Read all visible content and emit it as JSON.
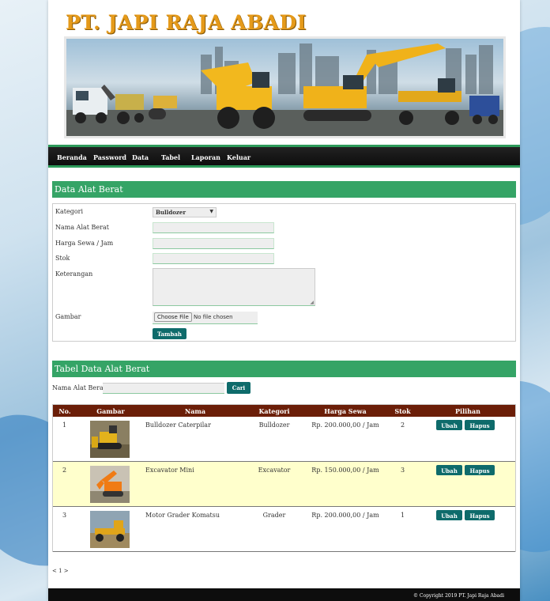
{
  "header": {
    "brand": "PT. JAPI RAJA ABADI"
  },
  "nav": [
    "Beranda",
    "Password",
    "Data",
    "Tabel",
    "Laporan",
    "Keluar"
  ],
  "form": {
    "title": "Data Alat Berat",
    "labels": {
      "kategori": "Kategori",
      "nama": "Nama Alat Berat",
      "harga": "Harga Sewa / Jam",
      "stok": "Stok",
      "keterangan": "Keterangan",
      "gambar": "Gambar"
    },
    "kategori_value": "Bulldozer",
    "file_button": "Choose File",
    "file_status": "No file chosen",
    "submit": "Tambah"
  },
  "table": {
    "title": "Tabel Data Alat Berat",
    "search_label": "Nama Alat Berat :",
    "search_button": "Cari",
    "headers": [
      "No.",
      "Gambar",
      "Nama",
      "Kategori",
      "Harga Sewa",
      "Stok",
      "Pilihan"
    ],
    "rows": [
      {
        "no": "1",
        "nama": "Bulldozer Caterpilar",
        "kategori": "Bulldozer",
        "harga": "Rp. 200.000,00 / Jam",
        "stok": "2"
      },
      {
        "no": "2",
        "nama": "Excavator Mini",
        "kategori": "Excavator",
        "harga": "Rp. 150.000,00 / Jam",
        "stok": "3"
      },
      {
        "no": "3",
        "nama": "Motor Grader Komatsu",
        "kategori": "Grader",
        "harga": "Rp. 200.000,00 / Jam",
        "stok": "1"
      }
    ],
    "edit_label": "Ubah",
    "delete_label": "Hapus"
  },
  "pager": "< 1 >",
  "footer": "© Copyright 2019 PT. Japi Raja Abadi",
  "colors": {
    "brand": "#e59a1a",
    "nav_bg": "#111111",
    "nav_border": "#2d9a5a",
    "panel_title": "#35a466",
    "table_header": "#6b1e08",
    "button": "#0e6b6b",
    "row_alt": "#ffffcc"
  }
}
